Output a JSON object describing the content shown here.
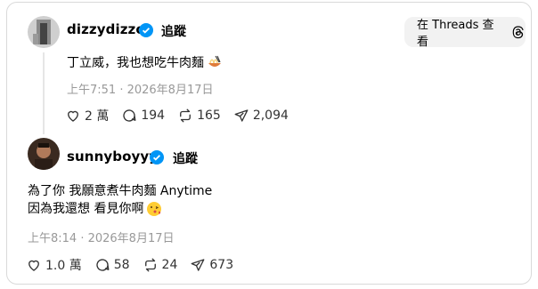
{
  "open_button": {
    "label": "在 Threads 查看",
    "icon": "threads-logo-icon"
  },
  "posts": [
    {
      "username": "dizzydizzo",
      "verified": true,
      "follow_label": "追蹤",
      "text": "丁立威，我也想吃牛肉麵",
      "emoji": "noodles-emoji",
      "timestamp": "上午7:51 · 2026年8月17日",
      "likes": "2 萬",
      "replies": "194",
      "reposts": "165",
      "shares": "2,094"
    },
    {
      "username": "sunnyboyyy",
      "verified": true,
      "follow_label": "追蹤",
      "text_line1": "為了你 我願意煮牛肉麵 Anytime",
      "text_line2": "因為我還想 看見你啊",
      "emoji": "kiss-emoji",
      "timestamp": "上午8:14 · 2026年8月17日",
      "likes": "1.0 萬",
      "replies": "58",
      "reposts": "24",
      "shares": "673"
    }
  ],
  "colors": {
    "verified": "#0095f6",
    "muted": "#999999",
    "line": "#e6e6e6"
  }
}
